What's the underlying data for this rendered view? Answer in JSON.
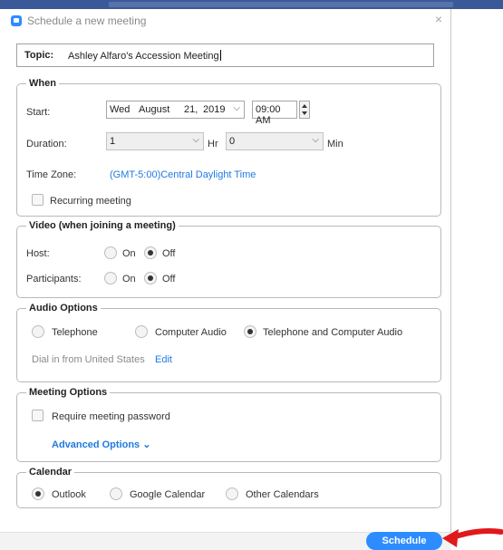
{
  "window": {
    "title": "Schedule a new meeting",
    "close_glyph": "×"
  },
  "topic": {
    "label": "Topic:",
    "value": "Ashley Alfaro's Accession Meeting"
  },
  "when": {
    "legend": "When",
    "start_label": "Start:",
    "date": {
      "weekday": "Wed",
      "month": "August",
      "day": "21,",
      "year": "2019"
    },
    "time": "09:00 AM",
    "duration_label": "Duration:",
    "duration_hours": "1",
    "hr_label": "Hr",
    "duration_minutes": "0",
    "min_label": "Min",
    "timezone_label": "Time Zone:",
    "timezone_value": "(GMT-5:00)Central Daylight Time",
    "recurring_label": "Recurring meeting"
  },
  "video": {
    "legend": "Video (when joining a meeting)",
    "host_label": "Host:",
    "participants_label": "Participants:",
    "on_label": "On",
    "off_label": "Off",
    "host_selected": "Off",
    "participants_selected": "Off"
  },
  "audio": {
    "legend": "Audio Options",
    "options": [
      "Telephone",
      "Computer Audio",
      "Telephone and Computer Audio"
    ],
    "selected": "Telephone and Computer Audio",
    "dial_in_text": "Dial in from United States",
    "edit_label": "Edit"
  },
  "meeting_options": {
    "legend": "Meeting Options",
    "password_label": "Require meeting password",
    "advanced_label": "Advanced Options"
  },
  "calendar": {
    "legend": "Calendar",
    "options": [
      "Outlook",
      "Google Calendar",
      "Other Calendars"
    ],
    "selected": "Outlook"
  },
  "actions": {
    "schedule_label": "Schedule"
  },
  "colors": {
    "accent": "#2d8cff",
    "link": "#1f7ae0",
    "pointer": "#e0191b"
  }
}
